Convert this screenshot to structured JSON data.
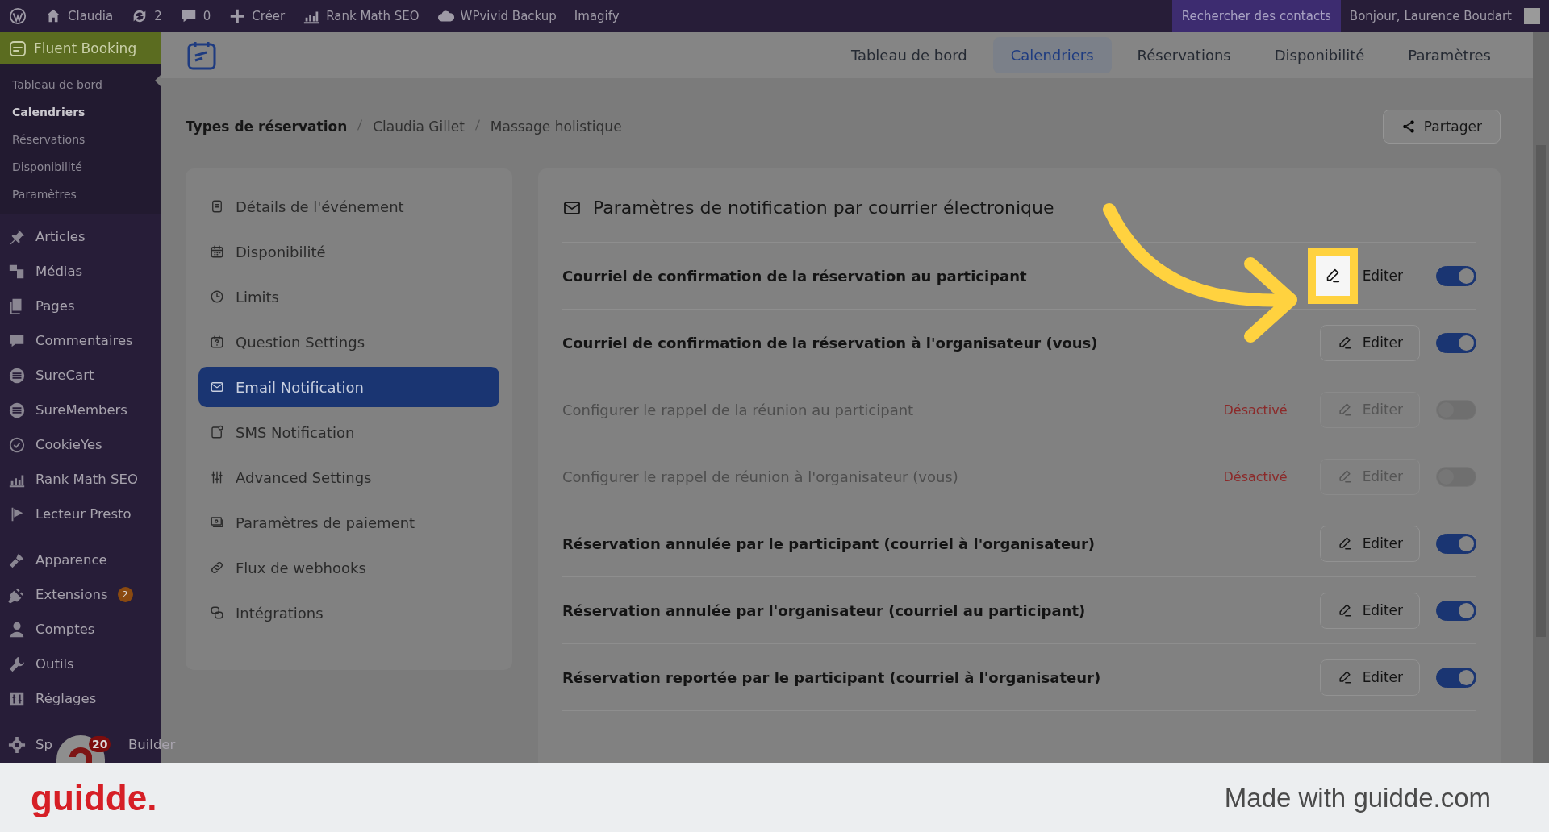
{
  "admin_bar": {
    "items": [
      {
        "kind": "logo"
      },
      {
        "kind": "home",
        "label": "Claudia"
      },
      {
        "kind": "updates",
        "label": "2"
      },
      {
        "kind": "comments",
        "label": "0"
      },
      {
        "kind": "new",
        "label": "Créer"
      },
      {
        "kind": "chart",
        "label": "Rank Math SEO"
      },
      {
        "kind": "cloud",
        "label": "WPvivid Backup"
      },
      {
        "kind": "text",
        "label": "Imagify"
      }
    ],
    "search_contacts": "Rechercher des contacts",
    "greeting": "Bonjour, Laurence Boudart"
  },
  "sidebar": {
    "plugin": "Fluent Booking",
    "submenu": [
      {
        "label": "Tableau de bord",
        "selected": false
      },
      {
        "label": "Calendriers",
        "selected": true
      },
      {
        "label": "Réservations",
        "selected": false
      },
      {
        "label": "Disponibilité",
        "selected": false
      },
      {
        "label": "Paramètres",
        "selected": false
      }
    ],
    "groups": [
      [
        {
          "label": "Articles"
        },
        {
          "label": "Médias"
        },
        {
          "label": "Pages"
        },
        {
          "label": "Commentaires"
        },
        {
          "label": "SureCart"
        },
        {
          "label": "SureMembers"
        },
        {
          "label": "CookieYes"
        },
        {
          "label": "Rank Math SEO"
        },
        {
          "label": "Lecteur Presto"
        }
      ],
      [
        {
          "label": "Apparence"
        },
        {
          "label": "Extensions",
          "badge": "2"
        },
        {
          "label": "Comptes"
        },
        {
          "label": "Outils"
        },
        {
          "label": "Réglages"
        }
      ],
      [
        {
          "label": "Sp",
          "label_end": "Builder"
        }
      ]
    ],
    "floating_badge": "20"
  },
  "top_nav": [
    {
      "label": "Tableau de bord",
      "selected": false
    },
    {
      "label": "Calendriers",
      "selected": true
    },
    {
      "label": "Réservations",
      "selected": false
    },
    {
      "label": "Disponibilité",
      "selected": false
    },
    {
      "label": "Paramètres",
      "selected": false
    }
  ],
  "breadcrumb": [
    "Types de réservation",
    "Claudia Gillet",
    "Massage holistique"
  ],
  "share_button": "Partager",
  "settings_menu": [
    {
      "label": "Détails de l'événement",
      "selected": false
    },
    {
      "label": "Disponibilité",
      "selected": false
    },
    {
      "label": "Limits",
      "selected": false
    },
    {
      "label": "Question Settings",
      "selected": false
    },
    {
      "label": "Email Notification",
      "selected": true
    },
    {
      "label": "SMS Notification",
      "selected": false
    },
    {
      "label": "Advanced Settings",
      "selected": false
    },
    {
      "label": "Paramètres de paiement",
      "selected": false
    },
    {
      "label": "Flux de webhooks",
      "selected": false
    },
    {
      "label": "Intégrations",
      "selected": false
    }
  ],
  "panel": {
    "title": "Paramètres de notification par courrier électronique",
    "rows": [
      {
        "label": "Courriel de confirmation de la réservation au participant",
        "on": true,
        "button": "Editer",
        "highlighted": true
      },
      {
        "label": "Courriel de confirmation de la réservation à l'organisateur (vous)",
        "on": true,
        "button": "Editer",
        "highlighted": false
      },
      {
        "label": "Configurer le rappel de la réunion au participant",
        "on": false,
        "status": "Désactivé",
        "button": "Editer",
        "highlighted": false
      },
      {
        "label": "Configurer le rappel de réunion à l'organisateur (vous)",
        "on": false,
        "status": "Désactivé",
        "button": "Editer",
        "highlighted": false
      },
      {
        "label": "Réservation annulée par le participant (courriel à l'organisateur)",
        "on": true,
        "button": "Editer",
        "highlighted": false
      },
      {
        "label": "Réservation annulée par l'organisateur (courriel au participant)",
        "on": true,
        "button": "Editer",
        "highlighted": false
      },
      {
        "label": "Réservation reportée par le participant (courriel à l'organisateur)",
        "on": true,
        "button": "Editer",
        "highlighted": false
      }
    ]
  },
  "footer": {
    "brand": "guidde.",
    "credit": "Made with guidde.com"
  }
}
